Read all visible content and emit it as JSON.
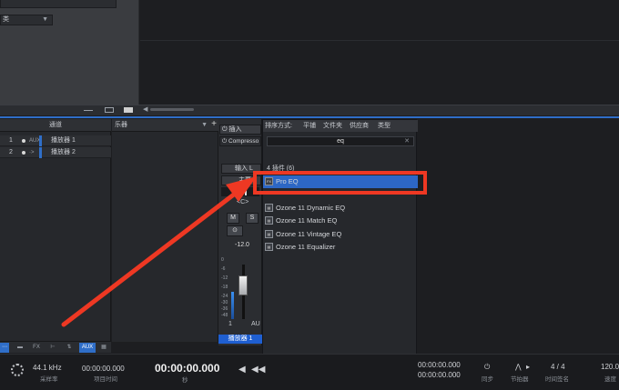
{
  "top_left": {
    "row1": "",
    "row2_label": "类"
  },
  "channel_panel": {
    "header": "通道",
    "rows": [
      {
        "num": "1",
        "icon": "AUX",
        "name": "播放器 1"
      },
      {
        "num": "2",
        "icon": "·>",
        "name": "播放器 2"
      }
    ]
  },
  "instrument_panel": {
    "header": "乐器",
    "add": "+"
  },
  "mixer": {
    "insert_label": "插入",
    "insert_item": "Compresso",
    "input_label": "输入 L",
    "main_label": "主要",
    "pan": "<C>",
    "mute": "M",
    "solo": "S",
    "volume": "-12.0",
    "scale": [
      "0",
      "-6",
      "-12",
      "-18",
      "-24",
      "-30",
      "-36",
      "-48"
    ],
    "channel_num": "1",
    "channel_type": "AU",
    "channel_name": "播放器 1"
  },
  "browser": {
    "sort_label": "排序方式:",
    "sort_options": [
      "平铺",
      "文件夹",
      "供应商",
      "类型"
    ],
    "search_value": "eq",
    "group_header": "4 插件 (6)",
    "items": [
      {
        "name": "Pro EQ",
        "selected": true
      },
      {
        "name": "Ozone 11 Dynamic EQ",
        "selected": false
      },
      {
        "name": "Ozone 11 Match EQ",
        "selected": false
      },
      {
        "name": "Ozone 11 Vintage EQ",
        "selected": false
      },
      {
        "name": "Ozone 11 Equalizer",
        "selected": false
      }
    ]
  },
  "bottom_toolbar": [
    "FX",
    "AUX"
  ],
  "transport": {
    "sample_rate": "44.1 kHz",
    "sample_rate_label": "采样率",
    "project_time": "00:00:00.000",
    "project_time_label": "项目时间",
    "main_time": "00:00:00.000",
    "main_time_unit": "秒",
    "right_time": "00:00:00.000",
    "sync_label": "同步",
    "metronome_label": "节拍器",
    "time_sig": "4 / 4",
    "time_sig_label": "时间签名",
    "tempo": "120.0",
    "tempo_label": "速度"
  },
  "colors": {
    "accent": "#2f6ec8",
    "highlight": "#ee3823",
    "selected": "#2d67c5"
  }
}
